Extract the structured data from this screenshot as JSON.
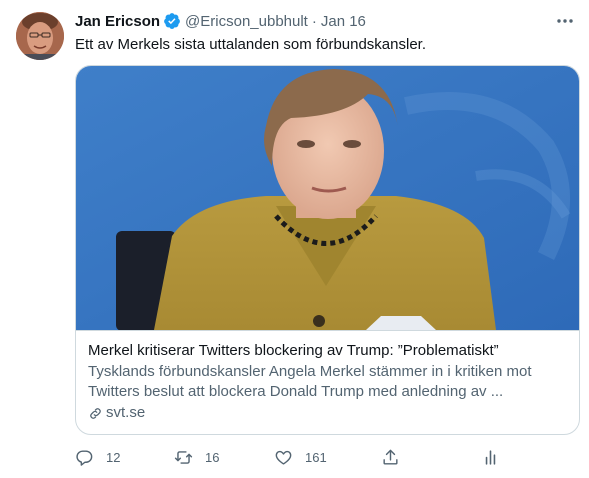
{
  "tweet": {
    "author": {
      "name": "Jan Ericson",
      "handle": "@Ericson_ubbhult",
      "verified": true,
      "avatar": "author-avatar"
    },
    "separator": "·",
    "date": "Jan 16",
    "text": "Ett av Merkels sista uttalanden som förbundskansler.",
    "card": {
      "image": "press-photo",
      "title": "Merkel kritiserar Twitters blockering av Trump: ”Problematiskt”",
      "description": "Tysklands förbundskansler Angela Merkel stämmer in i kritiken mot Twitters beslut att blockera Donald Trump med anledning av ...",
      "domain": "svt.se",
      "domain_icon": "link-icon"
    },
    "actions": {
      "reply": {
        "icon": "reply-icon",
        "count": "12"
      },
      "retweet": {
        "icon": "retweet-icon",
        "count": "16"
      },
      "like": {
        "icon": "heart-icon",
        "count": "161"
      },
      "share": {
        "icon": "share-icon"
      },
      "analytics": {
        "icon": "analytics-icon"
      }
    },
    "more_icon": "more-icon"
  },
  "colors": {
    "text_primary": "#0f1419",
    "text_secondary": "#536471",
    "verified": "#1d9bf0",
    "border": "#cfd9de"
  }
}
